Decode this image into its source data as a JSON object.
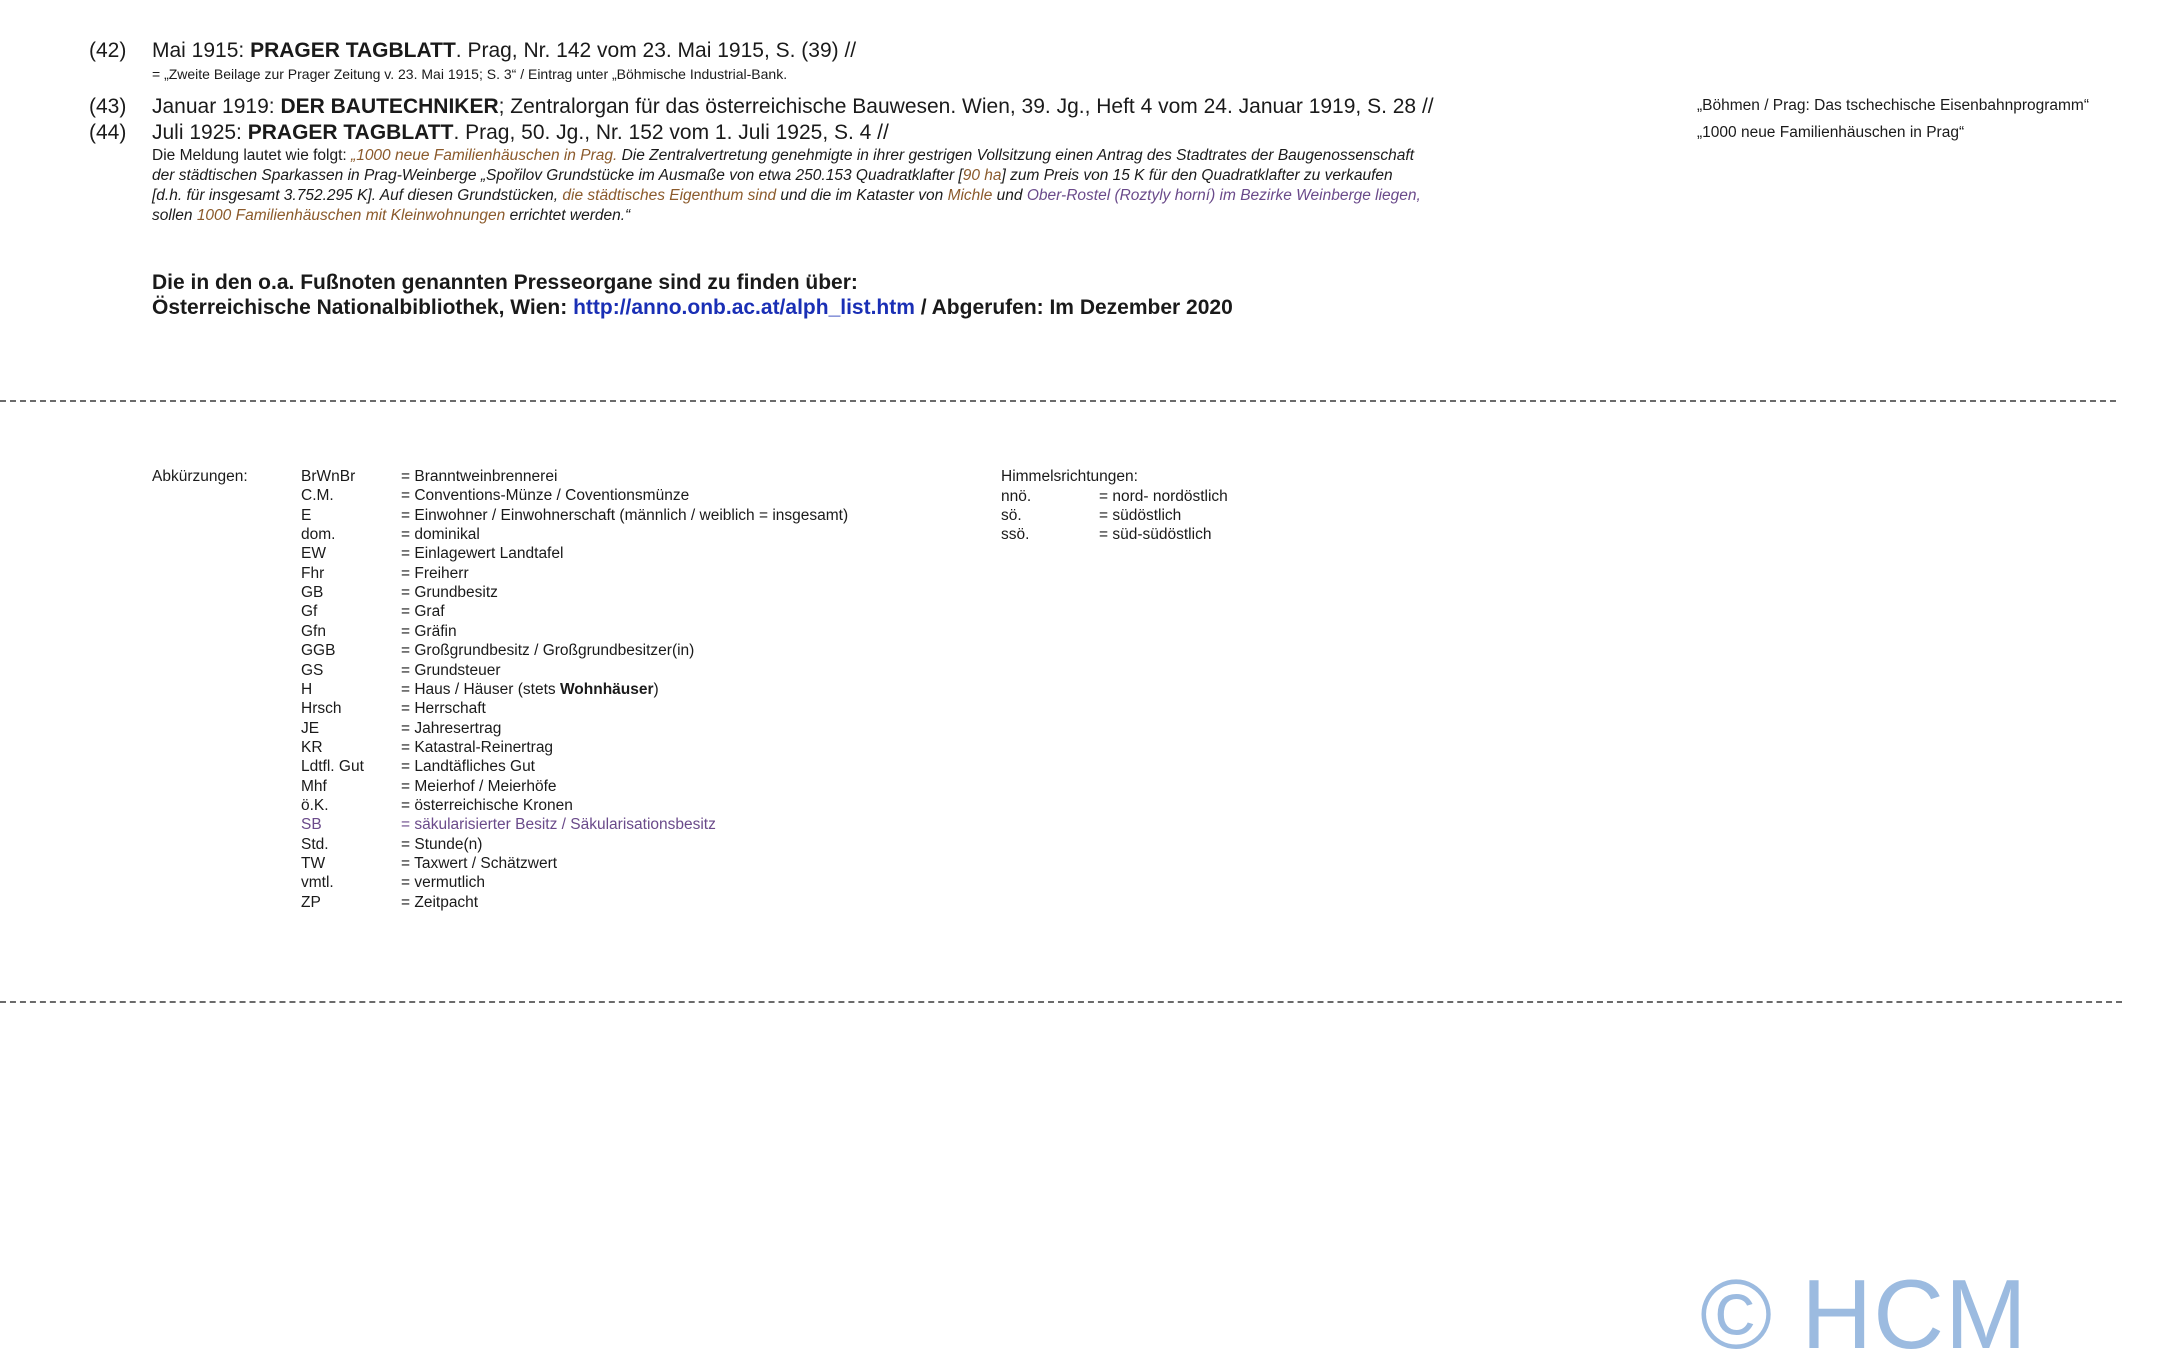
{
  "footnotes": [
    {
      "num": "(42)",
      "prefix": "Mai 1915: ",
      "bold": "PRAGER TAGBLATT",
      "rest": ". Prag, Nr. 142 vom 23. Mai 1915, S. (39) //",
      "sub": "= „Zweite Beilage zur Prager Zeitung v. 23. Mai 1915; S. 3“ / Eintrag unter „Böhmische Industrial-Bank."
    },
    {
      "num": "(43)",
      "prefix": "Januar 1919: ",
      "bold": "DER BAUTECHNIKER",
      "rest": "; Zentralorgan für das österreichische Bauwesen. Wien, 39. Jg., Heft 4 vom 24. Januar 1919, S. 28 //",
      "side": "„Böhmen / Prag: Das tschechische Eisenbahnprogramm“"
    },
    {
      "num": "(44)",
      "prefix": "Juli 1925: ",
      "bold": "PRAGER TAGBLATT",
      "rest": ". Prag, 50. Jg., Nr. 152 vom 1. Juli 1925, S. 4 //",
      "side": "„1000 neue Familienhäuschen in Prag“"
    }
  ],
  "quote": {
    "intro": "Die Meldung lautet wie folgt: ",
    "l1_a": "„1000 neue Familienhäuschen in Prag.",
    "l1_b": " Die Zentralvertretung genehmigte in ihrer gestrigen Vollsitzung einen Antrag des Stadtrates der Baugenossenschaft",
    "l2_a": "der städtischen Sparkassen in Prag-Weinberge „Spořilov Grundstücke im Ausmaße von etwa 250.153 Quadratklafter [",
    "l2_b": "90 ha",
    "l2_c": "] zum Preis von 15 K für den Quadratklafter zu verkaufen",
    "l3_a": "[d.h. für insgesamt 3.752.295 K]. Auf diesen Grundstücken, ",
    "l3_b": "die städtisches Eigenthum sind",
    "l3_c": " und die im Kataster von ",
    "l3_d": "Michle",
    "l3_e": " und ",
    "l3_f": "Ober-Rostel",
    "l3_g": " (",
    "l3_h": "Roztyly horní",
    "l3_i": ") im Bezirke Weinberge liegen,",
    "l4_a": "sollen ",
    "l4_b": "1000 Familienhäuschen mit Kleinwohnungen",
    "l4_c": " errichtet werden.“"
  },
  "source": {
    "line1": "Die in den o.a. Fußnoten genannten Presseorgane sind zu finden über:",
    "line2_a": "Österreichische Nationalbibliothek, Wien: ",
    "link": "http://anno.onb.ac.at/alph_list.htm",
    "line2_b": " / Abgerufen: Im Dezember 2020"
  },
  "abbreviations": {
    "label": "Abkürzungen:",
    "items": [
      {
        "key": "BrWnBr",
        "val": "= Branntweinbrennerei"
      },
      {
        "key": "C.M.",
        "val": "= Conventions-Münze / Coventionsmünze"
      },
      {
        "key": "E",
        "val": "= Einwohner / Einwohnerschaft (männlich / weiblich = insgesamt)"
      },
      {
        "key": "dom.",
        "val": "= dominikal"
      },
      {
        "key": "EW",
        "val": "= Einlagewert Landtafel"
      },
      {
        "key": "Fhr",
        "val": "= Freiherr"
      },
      {
        "key": "GB",
        "val": "= Grundbesitz"
      },
      {
        "key": "Gf",
        "val": "= Graf"
      },
      {
        "key": "Gfn",
        "val": "= Gräfin"
      },
      {
        "key": "GGB",
        "val": "= Großgrundbesitz / Großgrundbesitzer(in)"
      },
      {
        "key": "GS",
        "val": "= Grundsteuer"
      },
      {
        "key": "H",
        "val": "= Haus / Häuser (stets ",
        "bold": "Wohnhäuser",
        "tail": ")"
      },
      {
        "key": "Hrsch",
        "val": "= Herrschaft"
      },
      {
        "key": "JE",
        "val": "= Jahresertrag"
      },
      {
        "key": "KR",
        "val": "= Katastral-Reinertrag"
      },
      {
        "key": "Ldtfl. Gut",
        "val": "= Landtäfliches Gut"
      },
      {
        "key": "Mhf",
        "val": "= Meierhof / Meierhöfe"
      },
      {
        "key": "ö.K.",
        "val": "= österreichische Kronen"
      },
      {
        "key": "SB",
        "val": "= säkularisierter Besitz / Säkularisationsbesitz",
        "color": "#6a4a8a"
      },
      {
        "key": "Std.",
        "val": "= Stunde(n)"
      },
      {
        "key": "TW",
        "val": "= Taxwert / Schätzwert"
      },
      {
        "key": "vmtl.",
        "val": "= vermutlich"
      },
      {
        "key": "ZP",
        "val": "= Zeitpacht"
      }
    ]
  },
  "directions": {
    "label": "Himmelsrichtungen:",
    "items": [
      {
        "key": "nnö.",
        "val": "= nord- nordöstlich"
      },
      {
        "key": "sö.",
        "val": "= südöstlich"
      },
      {
        "key": "ssö.",
        "val": "= süd-südöstlich"
      }
    ]
  },
  "copyright": "© HCM"
}
